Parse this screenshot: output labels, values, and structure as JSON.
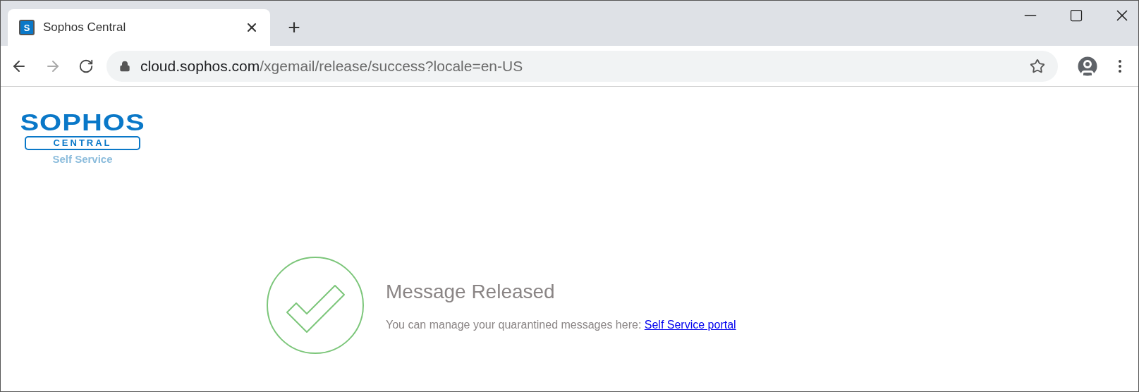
{
  "tabs": [
    {
      "title": "Sophos Central",
      "favicon": "S",
      "selected": true
    }
  ],
  "new_tab": "+",
  "address_bar": {
    "host": "cloud.sophos.com",
    "path": "/xgemail/release/success?locale=en-US"
  },
  "logo": {
    "brand": "SOPHOS",
    "product": "CENTRAL",
    "subtitle": "Self Service"
  },
  "message": {
    "title": "Message Released",
    "text": "You can manage your quarantined messages here: ",
    "link": "Self Service portal"
  }
}
